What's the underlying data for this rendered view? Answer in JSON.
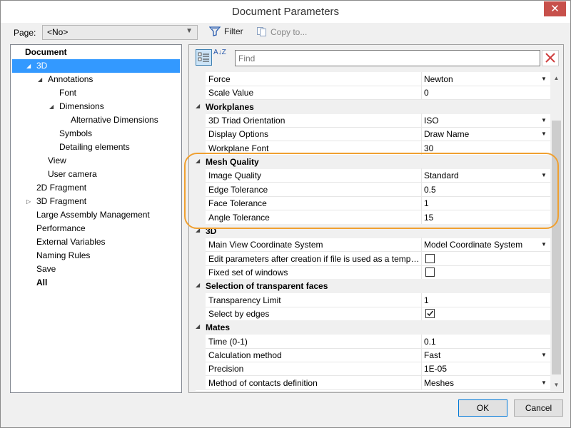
{
  "window": {
    "title": "Document Parameters",
    "close_glyph": "✕"
  },
  "toolbar": {
    "page_label": "Page:",
    "page_value": "<No>",
    "filter_label": "Filter",
    "copy_label": "Copy to..."
  },
  "tree": {
    "items": [
      {
        "label": "Document",
        "depth": 0,
        "toggle": "",
        "bold": true,
        "selected": false
      },
      {
        "label": "3D",
        "depth": 1,
        "toggle": "◢",
        "bold": false,
        "selected": true
      },
      {
        "label": "Annotations",
        "depth": 2,
        "toggle": "◢",
        "bold": false,
        "selected": false
      },
      {
        "label": "Font",
        "depth": 3,
        "toggle": "",
        "bold": false,
        "selected": false
      },
      {
        "label": "Dimensions",
        "depth": 3,
        "toggle": "◢",
        "bold": false,
        "selected": false
      },
      {
        "label": "Alternative Dimensions",
        "depth": 4,
        "toggle": "",
        "bold": false,
        "selected": false
      },
      {
        "label": "Symbols",
        "depth": 3,
        "toggle": "",
        "bold": false,
        "selected": false
      },
      {
        "label": "Detailing elements",
        "depth": 3,
        "toggle": "",
        "bold": false,
        "selected": false
      },
      {
        "label": "View",
        "depth": 2,
        "toggle": "",
        "bold": false,
        "selected": false
      },
      {
        "label": "User camera",
        "depth": 2,
        "toggle": "",
        "bold": false,
        "selected": false
      },
      {
        "label": "2D Fragment",
        "depth": 1,
        "toggle": "",
        "bold": false,
        "selected": false
      },
      {
        "label": "3D Fragment",
        "depth": 1,
        "toggle": "▷",
        "bold": false,
        "selected": false
      },
      {
        "label": "Large Assembly Management",
        "depth": 1,
        "toggle": "",
        "bold": false,
        "selected": false
      },
      {
        "label": "Performance",
        "depth": 1,
        "toggle": "",
        "bold": false,
        "selected": false
      },
      {
        "label": "External Variables",
        "depth": 1,
        "toggle": "",
        "bold": false,
        "selected": false
      },
      {
        "label": "Naming Rules",
        "depth": 1,
        "toggle": "",
        "bold": false,
        "selected": false
      },
      {
        "label": "Save",
        "depth": 1,
        "toggle": "",
        "bold": false,
        "selected": false
      },
      {
        "label": "All",
        "depth": 1,
        "toggle": "",
        "bold": true,
        "selected": false
      }
    ]
  },
  "grid": {
    "find_placeholder": "Find",
    "sort_glyph": "A↓Z",
    "rows": [
      {
        "kind": "prop",
        "name": "Force",
        "value": "Newton",
        "dropdown": true
      },
      {
        "kind": "prop",
        "name": "Scale Value",
        "value": "0",
        "dropdown": false
      },
      {
        "kind": "cat",
        "name": "Workplanes"
      },
      {
        "kind": "prop",
        "name": "3D Triad Orientation",
        "value": "ISO",
        "dropdown": true
      },
      {
        "kind": "prop",
        "name": "Display Options",
        "value": "Draw Name",
        "dropdown": true
      },
      {
        "kind": "prop",
        "name": "Workplane Font",
        "value": "30",
        "dropdown": false
      },
      {
        "kind": "cat",
        "name": "Mesh Quality"
      },
      {
        "kind": "prop",
        "name": "Image Quality",
        "value": "Standard",
        "dropdown": true
      },
      {
        "kind": "prop",
        "name": "Edge Tolerance",
        "value": "0.5",
        "dropdown": false
      },
      {
        "kind": "prop",
        "name": "Face Tolerance",
        "value": "1",
        "dropdown": false
      },
      {
        "kind": "prop",
        "name": "Angle Tolerance",
        "value": "15",
        "dropdown": false
      },
      {
        "kind": "cat",
        "name": "3D"
      },
      {
        "kind": "prop",
        "name": "Main View Coordinate System",
        "value": "Model Coordinate System",
        "dropdown": true
      },
      {
        "kind": "check",
        "name": "Edit parameters after creation if file is used as a template",
        "checked": false
      },
      {
        "kind": "check",
        "name": "Fixed set of windows",
        "checked": false
      },
      {
        "kind": "cat",
        "name": "Selection of transparent faces"
      },
      {
        "kind": "prop",
        "name": "Transparency Limit",
        "value": "1",
        "dropdown": false
      },
      {
        "kind": "check",
        "name": "Select by edges",
        "checked": true
      },
      {
        "kind": "cat",
        "name": "Mates"
      },
      {
        "kind": "prop",
        "name": "Time (0-1)",
        "value": "0.1",
        "dropdown": false
      },
      {
        "kind": "prop",
        "name": "Calculation method",
        "value": "Fast",
        "dropdown": true
      },
      {
        "kind": "prop",
        "name": "Precision",
        "value": "1E-05",
        "dropdown": false
      },
      {
        "kind": "prop",
        "name": "Method of contacts definition",
        "value": "Meshes",
        "dropdown": true
      }
    ]
  },
  "buttons": {
    "ok": "OK",
    "cancel": "Cancel"
  },
  "colors": {
    "selection": "#3399ff",
    "highlight": "#f0a030",
    "close": "#c7504b"
  },
  "icons": {
    "filter": "filter-icon",
    "copy": "copy-icon",
    "categorized": "categorized-view-icon",
    "sort": "sort-az-icon",
    "clear": "clear-x-icon"
  }
}
